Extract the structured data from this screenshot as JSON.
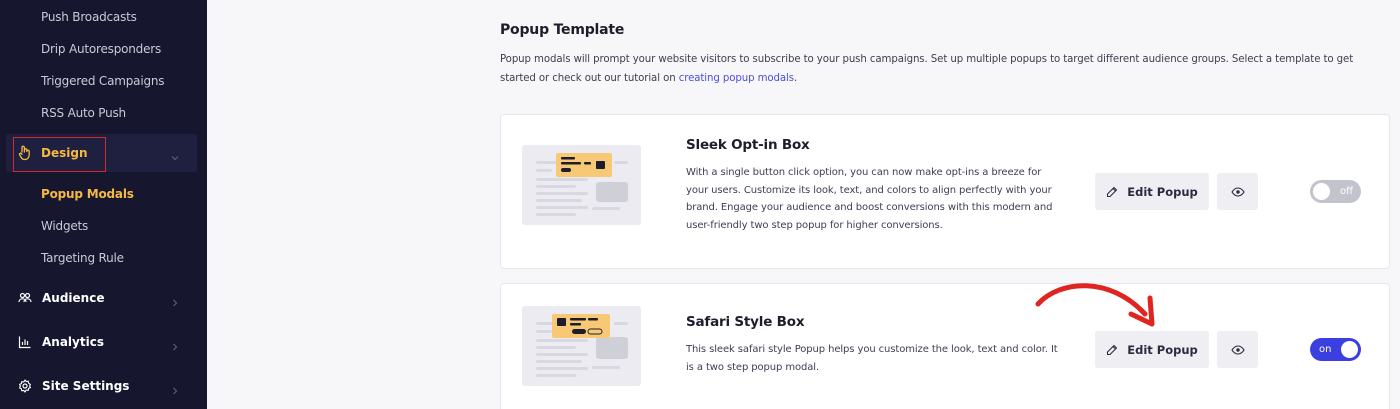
{
  "sidebar": {
    "sub_items_top": [
      {
        "label": "Push Broadcasts"
      },
      {
        "label": "Drip Autoresponders"
      },
      {
        "label": "Triggered Campaigns"
      },
      {
        "label": "RSS Auto Push"
      }
    ],
    "design": {
      "label": "Design",
      "icon": "hand-pointer-icon",
      "color": "#f5b942"
    },
    "design_sub_items": [
      {
        "label": "Popup Modals",
        "active": true
      },
      {
        "label": "Widgets"
      },
      {
        "label": "Targeting Rule"
      }
    ],
    "main_items": [
      {
        "label": "Audience",
        "icon": "users-icon"
      },
      {
        "label": "Analytics",
        "icon": "bar-chart-icon"
      },
      {
        "label": "Site Settings",
        "icon": "gear-icon"
      }
    ]
  },
  "main": {
    "title": "Popup Template",
    "description": "Popup modals will prompt your website visitors to subscribe to your push campaigns. Set up multiple popups to target different audience groups. Select a template to get started or check out our tutorial on ",
    "description_link": "creating popup modals",
    "description_end": ".",
    "templates": [
      {
        "name": "Sleek Opt-in Box",
        "text": "With a single button click option, you can now make opt-ins a breeze for your users. Customize its look, text, and colors to align perfectly with your brand. Engage your audience and boost conversions with this modern and user-friendly two step popup for higher conversions.",
        "edit_label": "Edit Popup",
        "toggle_label": "off",
        "enabled": false
      },
      {
        "name": "Safari Style Box",
        "text": "This sleek safari style Popup helps you customize the look, text and color. It is a two step popup modal.",
        "edit_label": "Edit Popup",
        "toggle_label": "on",
        "enabled": true
      }
    ]
  },
  "colors": {
    "sidebar_bg": "#16172e",
    "accent": "#f5b942",
    "toggle_on": "#3b3fe0",
    "link": "#4d4ee0",
    "annotation": "#e0241f"
  }
}
